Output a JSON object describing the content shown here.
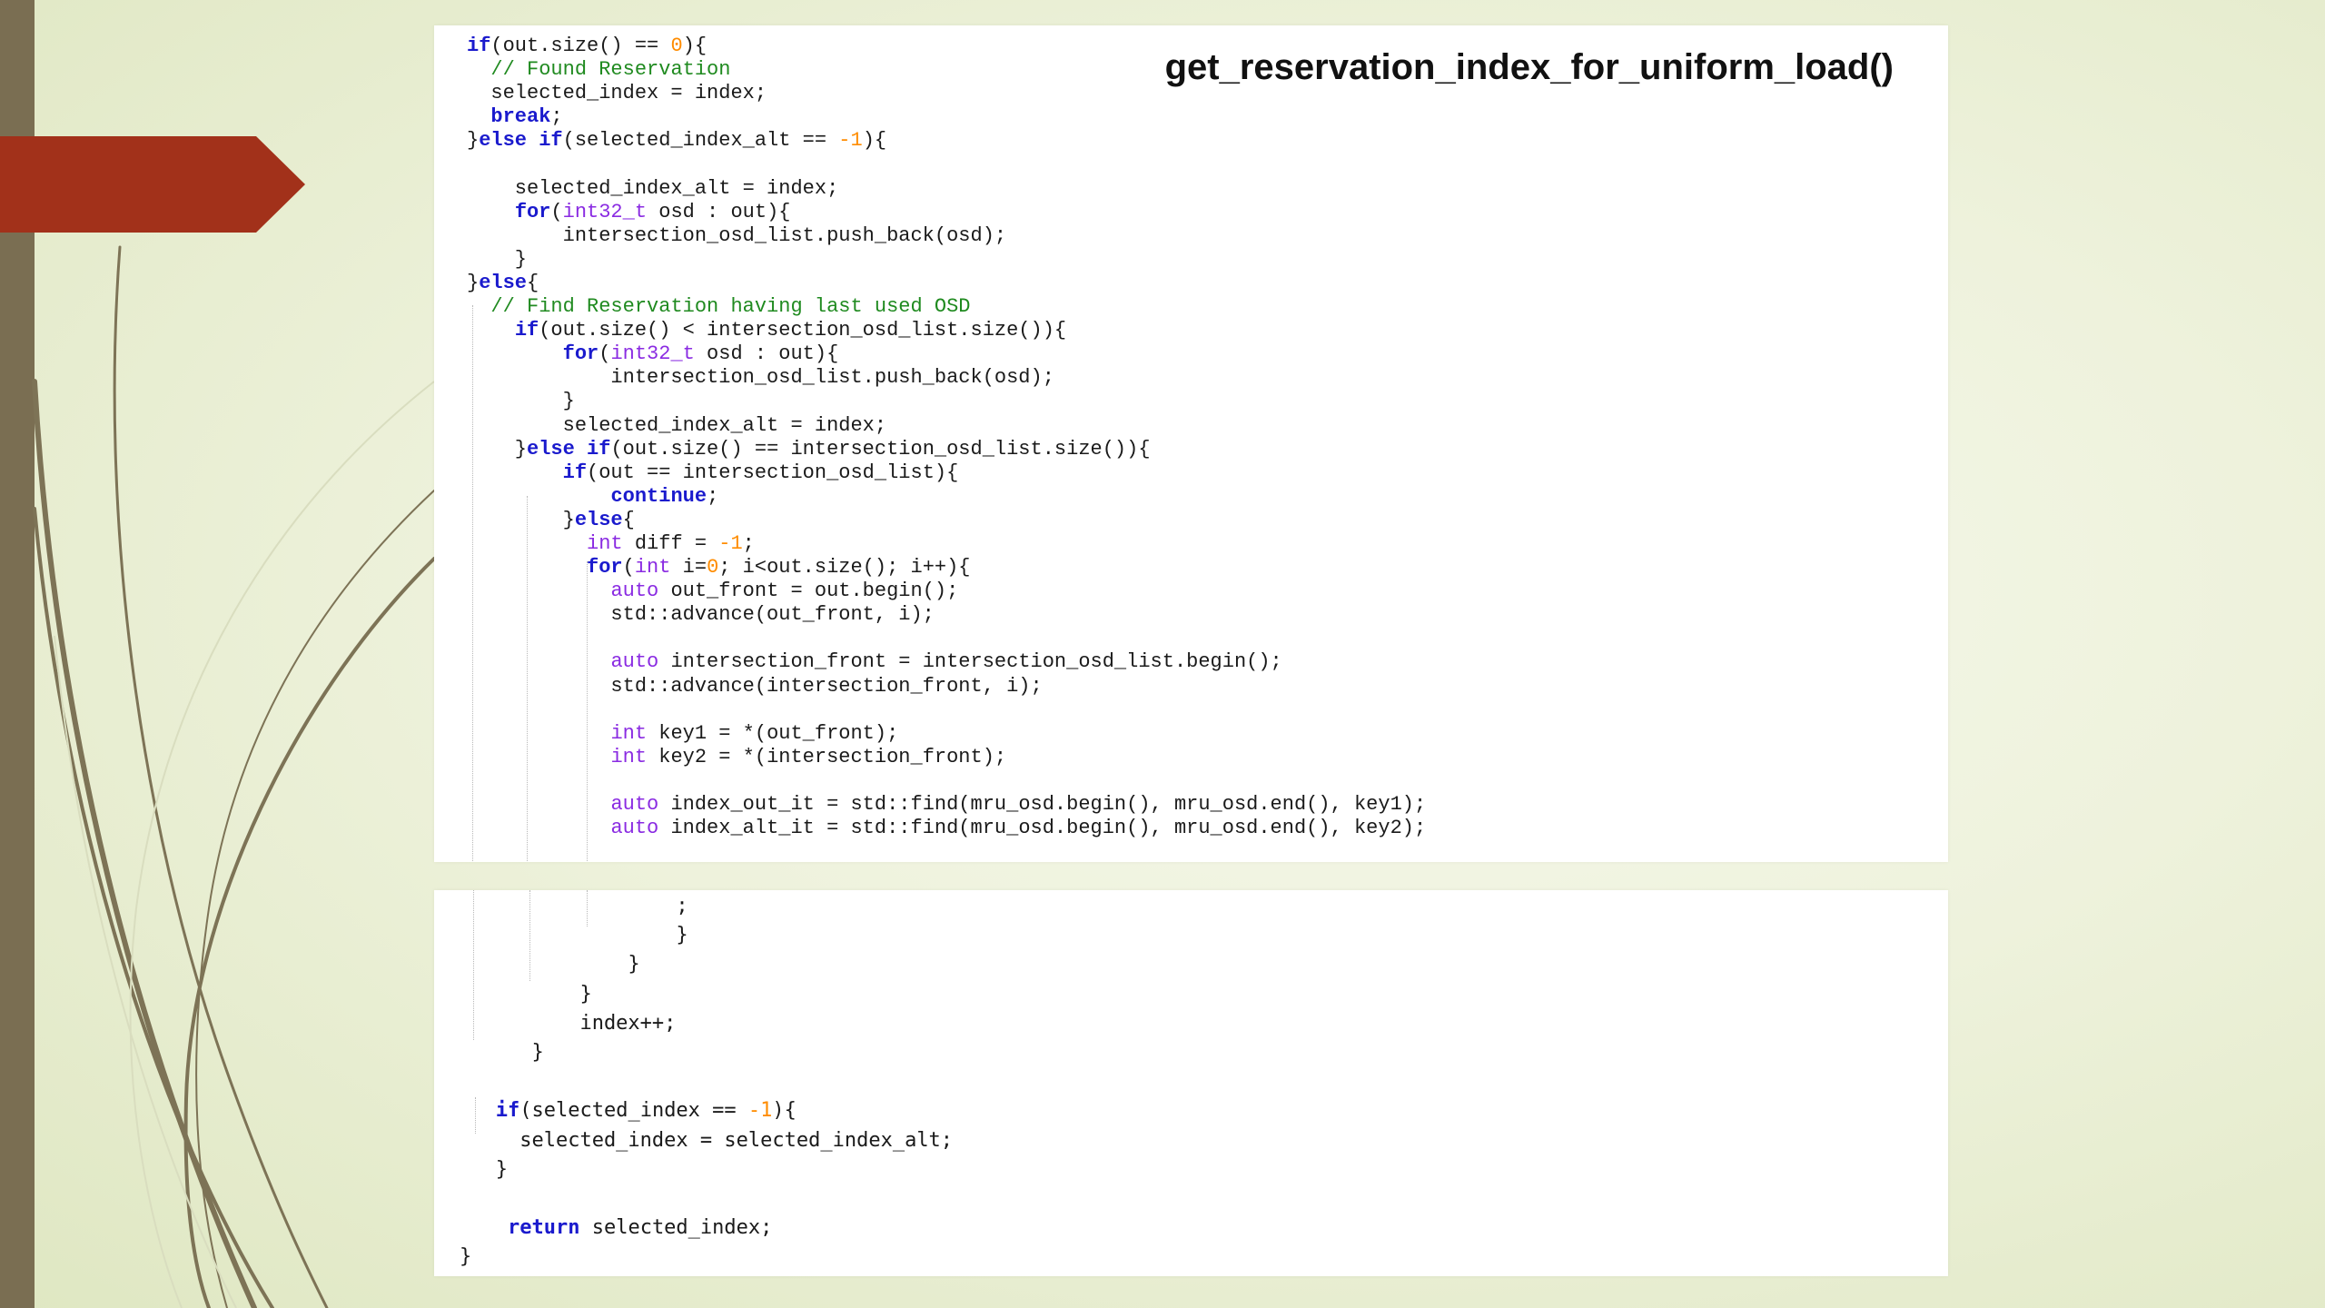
{
  "slide": {
    "title": "get_reservation_index_for_uniform_load()",
    "colors": {
      "accent_arrow": "#a2311a",
      "left_bar": "#7a6e52",
      "swoosh": "#7d7356",
      "background": "#eef2dc"
    }
  },
  "code_top": [
    [
      {
        "t": "if",
        "c": "kw"
      },
      {
        "t": "(out.size() == "
      },
      {
        "t": "0",
        "c": "num"
      },
      {
        "t": "){"
      }
    ],
    [
      {
        "t": "  "
      },
      {
        "t": "// Found Reservation",
        "c": "cm"
      }
    ],
    [
      {
        "t": "  selected_index = index;"
      }
    ],
    [
      {
        "t": "  "
      },
      {
        "t": "break",
        "c": "kw"
      },
      {
        "t": ";"
      }
    ],
    [
      {
        "t": "}"
      },
      {
        "t": "else if",
        "c": "kw"
      },
      {
        "t": "(selected_index_alt == "
      },
      {
        "t": "-1",
        "c": "num"
      },
      {
        "t": "){"
      }
    ],
    [
      {
        "t": ""
      }
    ],
    [
      {
        "t": "    selected_index_alt = index;"
      }
    ],
    [
      {
        "t": "    "
      },
      {
        "t": "for",
        "c": "kw"
      },
      {
        "t": "("
      },
      {
        "t": "int32_t",
        "c": "ty"
      },
      {
        "t": " osd : out){"
      }
    ],
    [
      {
        "t": "        intersection_osd_list.push_back(osd);"
      }
    ],
    [
      {
        "t": "    }"
      }
    ],
    [
      {
        "t": "}"
      },
      {
        "t": "else",
        "c": "kw"
      },
      {
        "t": "{"
      }
    ],
    [
      {
        "t": "  "
      },
      {
        "t": "// Find Reservation having last used OSD",
        "c": "cm"
      }
    ],
    [
      {
        "t": "    "
      },
      {
        "t": "if",
        "c": "kw"
      },
      {
        "t": "(out.size() < intersection_osd_list.size()){"
      }
    ],
    [
      {
        "t": "        "
      },
      {
        "t": "for",
        "c": "kw"
      },
      {
        "t": "("
      },
      {
        "t": "int32_t",
        "c": "ty"
      },
      {
        "t": " osd : out){"
      }
    ],
    [
      {
        "t": "            intersection_osd_list.push_back(osd);"
      }
    ],
    [
      {
        "t": "        }"
      }
    ],
    [
      {
        "t": "        selected_index_alt = index;"
      }
    ],
    [
      {
        "t": "    }"
      },
      {
        "t": "else if",
        "c": "kw"
      },
      {
        "t": "(out.size() == intersection_osd_list.size()){"
      }
    ],
    [
      {
        "t": "        "
      },
      {
        "t": "if",
        "c": "kw"
      },
      {
        "t": "(out == intersection_osd_list){"
      }
    ],
    [
      {
        "t": "            "
      },
      {
        "t": "continue",
        "c": "kw"
      },
      {
        "t": ";"
      }
    ],
    [
      {
        "t": "        }"
      },
      {
        "t": "else",
        "c": "kw"
      },
      {
        "t": "{"
      }
    ],
    [
      {
        "t": "          "
      },
      {
        "t": "int",
        "c": "ty"
      },
      {
        "t": " diff = "
      },
      {
        "t": "-1",
        "c": "num"
      },
      {
        "t": ";"
      }
    ],
    [
      {
        "t": "          "
      },
      {
        "t": "for",
        "c": "kw"
      },
      {
        "t": "("
      },
      {
        "t": "int",
        "c": "ty"
      },
      {
        "t": " i="
      },
      {
        "t": "0",
        "c": "num"
      },
      {
        "t": "; i<out.size(); i++){"
      }
    ],
    [
      {
        "t": "            "
      },
      {
        "t": "auto",
        "c": "ty"
      },
      {
        "t": " out_front = out.begin();"
      }
    ],
    [
      {
        "t": "            std::advance(out_front, i);"
      }
    ],
    [
      {
        "t": ""
      }
    ],
    [
      {
        "t": "            "
      },
      {
        "t": "auto",
        "c": "ty"
      },
      {
        "t": " intersection_front = intersection_osd_list.begin();"
      }
    ],
    [
      {
        "t": "            std::advance(intersection_front, i);"
      }
    ],
    [
      {
        "t": ""
      }
    ],
    [
      {
        "t": "            "
      },
      {
        "t": "int",
        "c": "ty"
      },
      {
        "t": " key1 = *(out_front);"
      }
    ],
    [
      {
        "t": "            "
      },
      {
        "t": "int",
        "c": "ty"
      },
      {
        "t": " key2 = *(intersection_front);"
      }
    ],
    [
      {
        "t": ""
      }
    ],
    [
      {
        "t": "            "
      },
      {
        "t": "auto",
        "c": "ty"
      },
      {
        "t": " index_out_it = std::find(mru_osd.begin(), mru_osd.end(), key1);"
      }
    ],
    [
      {
        "t": "            "
      },
      {
        "t": "auto",
        "c": "ty"
      },
      {
        "t": " index_alt_it = std::find(mru_osd.begin(), mru_osd.end(), key2);"
      }
    ]
  ],
  "code_bottom": [
    [
      {
        "t": "                  ;"
      }
    ],
    [
      {
        "t": "                  }"
      }
    ],
    [
      {
        "t": "              }"
      }
    ],
    [
      {
        "t": "          }"
      }
    ],
    [
      {
        "t": "          index++;"
      }
    ],
    [
      {
        "t": "      }"
      }
    ],
    [
      {
        "t": ""
      }
    ],
    [
      {
        "t": "   "
      },
      {
        "t": "if",
        "c": "kw"
      },
      {
        "t": "(selected_index == "
      },
      {
        "t": "-1",
        "c": "num"
      },
      {
        "t": "){"
      }
    ],
    [
      {
        "t": "     selected_index = selected_index_alt;"
      }
    ],
    [
      {
        "t": "   }"
      }
    ],
    [
      {
        "t": ""
      }
    ],
    [
      {
        "t": "    "
      },
      {
        "t": "return",
        "c": "kw"
      },
      {
        "t": " selected_index;"
      }
    ],
    [
      {
        "t": "}"
      }
    ]
  ]
}
